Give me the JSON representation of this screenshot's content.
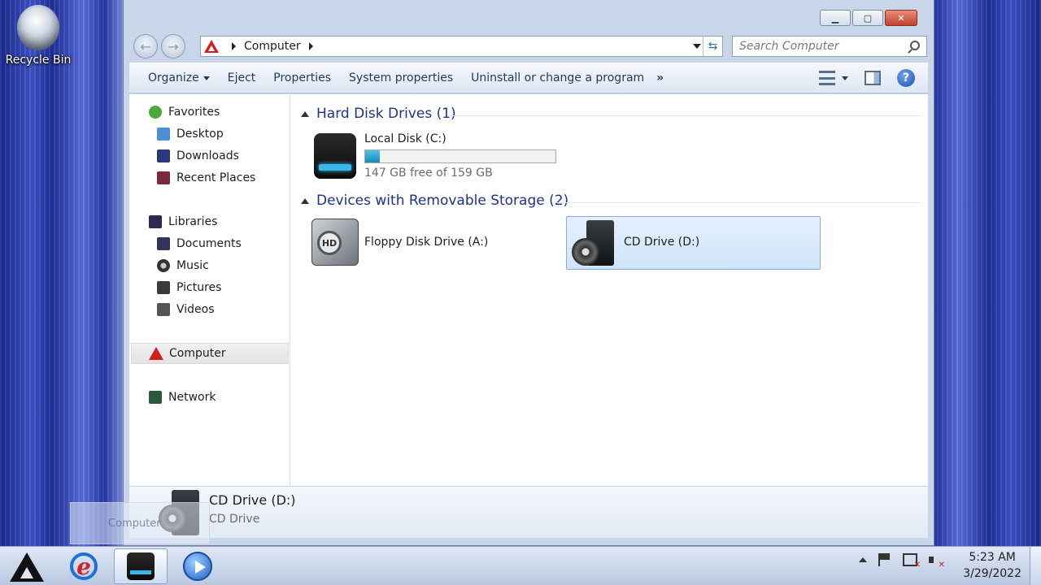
{
  "desktop": {
    "recycle_bin_label": "Recycle Bin"
  },
  "window": {
    "address": {
      "location": "Computer"
    },
    "search": {
      "placeholder": "Search Computer"
    },
    "commands": {
      "organize": "Organize",
      "eject": "Eject",
      "properties": "Properties",
      "system_properties": "System properties",
      "uninstall": "Uninstall or change a program",
      "more": "»"
    },
    "nav": {
      "favorites": "Favorites",
      "desktop": "Desktop",
      "downloads": "Downloads",
      "recent_places": "Recent Places",
      "libraries": "Libraries",
      "documents": "Documents",
      "music": "Music",
      "pictures": "Pictures",
      "videos": "Videos",
      "computer": "Computer",
      "network": "Network"
    },
    "groups": {
      "hard_disk": "Hard Disk Drives (1)",
      "removable": "Devices with Removable Storage (2)"
    },
    "drives": {
      "local_disk": {
        "name": "Local Disk (C:)",
        "free_text": "147 GB free of 159 GB",
        "used_fraction": 0.075
      },
      "floppy": {
        "name": "Floppy Disk Drive (A:)",
        "icon_label": "HD"
      },
      "cd": {
        "name": "CD Drive (D:)"
      }
    },
    "details": {
      "name": "CD Drive (D:)",
      "type": "CD Drive"
    },
    "drag_ghost_label": "Computer"
  },
  "taskbar": {
    "ie_glyph": "e",
    "clock_time": "5:23 AM",
    "clock_date": "3/29/2022"
  },
  "colors": {
    "accent_red": "#d21e1e",
    "selection": "#cfe3fb",
    "drive_fill": "#38b7e8"
  }
}
